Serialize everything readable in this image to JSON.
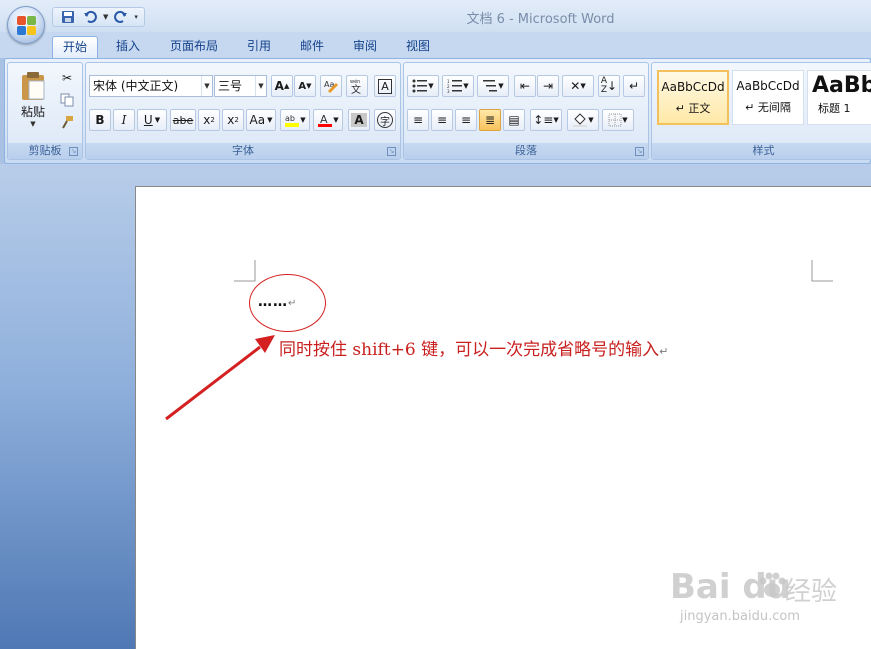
{
  "window": {
    "title": "文档 6 - Microsoft Word"
  },
  "quick_access": {
    "icons": [
      "save-icon",
      "undo-icon",
      "redo-icon",
      "customize-icon"
    ]
  },
  "tabs": [
    {
      "label": "开始",
      "active": true
    },
    {
      "label": "插入"
    },
    {
      "label": "页面布局"
    },
    {
      "label": "引用"
    },
    {
      "label": "邮件"
    },
    {
      "label": "审阅"
    },
    {
      "label": "视图"
    }
  ],
  "ribbon": {
    "clipboard": {
      "label": "剪贴板",
      "paste_label": "粘贴"
    },
    "font": {
      "label": "字体",
      "font_name": "宋体 (中文正文)",
      "font_size": "三号",
      "buttons": [
        "B",
        "I",
        "U",
        "abe",
        "x₂",
        "x²",
        "Aa",
        "A",
        "A"
      ],
      "highlight_color": "#ffff00",
      "font_color": "#ff0000"
    },
    "paragraph": {
      "label": "段落"
    },
    "styles": {
      "label": "样式",
      "items": [
        {
          "sample": "AaBbCcDd",
          "name": "↵ 正文",
          "selected": true
        },
        {
          "sample": "AaBbCcDd",
          "name": "↵ 无间隔"
        },
        {
          "sample": "AaBb",
          "name": "标题 1"
        }
      ]
    }
  },
  "document": {
    "ellipsis": "……",
    "paragraph_mark": "↵",
    "annotation": "同时按住 shift+6 键，可以一次完成省略号的输入",
    "annotation_color": "#c8201e"
  },
  "watermark": {
    "logo": "Bai du",
    "brand": "经验",
    "url": "jingyan.baidu.com"
  }
}
